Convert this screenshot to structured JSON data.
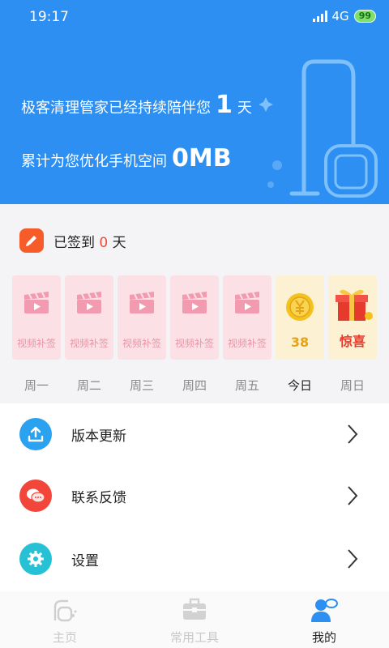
{
  "status_bar": {
    "time": "19:17",
    "network": "4G",
    "battery": "99"
  },
  "header": {
    "line1_prefix": "极客清理管家已经持续陪伴您",
    "days_value": "1",
    "line1_suffix": "天",
    "line2_prefix": "累计为您优化手机空间",
    "space_value": "0MB",
    "bg_color": "#2d8ff2"
  },
  "checkin": {
    "label_prefix": "已签到",
    "count": "0",
    "label_suffix": "天",
    "icon": "pencil-icon",
    "days": [
      {
        "caption": "视频补签",
        "icon": "clapperboard-icon"
      },
      {
        "caption": "视频补签",
        "icon": "clapperboard-icon"
      },
      {
        "caption": "视频补签",
        "icon": "clapperboard-icon"
      },
      {
        "caption": "视频补签",
        "icon": "clapperboard-icon"
      },
      {
        "caption": "视频补签",
        "icon": "clapperboard-icon"
      },
      {
        "caption": "38",
        "icon": "coin-icon"
      },
      {
        "caption": "惊喜",
        "icon": "gift-icon"
      }
    ],
    "weekdays": [
      "周一",
      "周二",
      "周三",
      "周四",
      "周五",
      "今日",
      "周日"
    ]
  },
  "menu": [
    {
      "label": "版本更新",
      "icon": "upload-icon",
      "color": "#2aa2f0"
    },
    {
      "label": "联系反馈",
      "icon": "chat-bubbles-icon",
      "color": "#f2463a"
    },
    {
      "label": "设置",
      "icon": "gear-icon",
      "color": "#27c1d6"
    }
  ],
  "tabbar": {
    "tabs": [
      {
        "label": "主页",
        "icon": "vacuum-icon"
      },
      {
        "label": "常用工具",
        "icon": "toolbox-icon"
      },
      {
        "label": "我的",
        "icon": "user-icon"
      }
    ],
    "active_index": 2
  }
}
